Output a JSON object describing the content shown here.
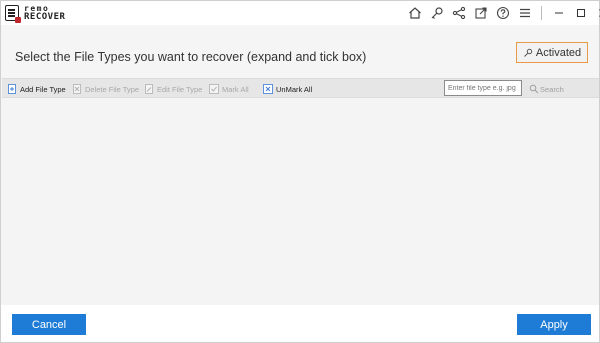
{
  "logo": {
    "line1": "remo",
    "line2": "RECOVER"
  },
  "titlebar": {
    "icons": [
      "home-icon",
      "key-icon",
      "share-icon",
      "export-icon",
      "help-icon",
      "menu-icon"
    ],
    "window_controls": [
      "minimize-icon",
      "maximize-icon",
      "close-icon"
    ]
  },
  "header": {
    "instruction": "Select the File Types you want to recover (expand and tick box)",
    "activated_label": "Activated"
  },
  "toolbar": {
    "add_file_type": "Add File Type",
    "delete_file_type": "Delete File Type",
    "edit_file_type": "Edit File Type",
    "mark_all": "Mark All",
    "unmark_all": "UnMark All",
    "search_placeholder": "Enter file type e.g. jpg",
    "search_label": "Search"
  },
  "footer": {
    "cancel_label": "Cancel",
    "apply_label": "Apply"
  },
  "colors": {
    "accent_blue": "#1e7cd6",
    "activated_border": "#e69a4a",
    "brand_red": "#c0272d"
  }
}
